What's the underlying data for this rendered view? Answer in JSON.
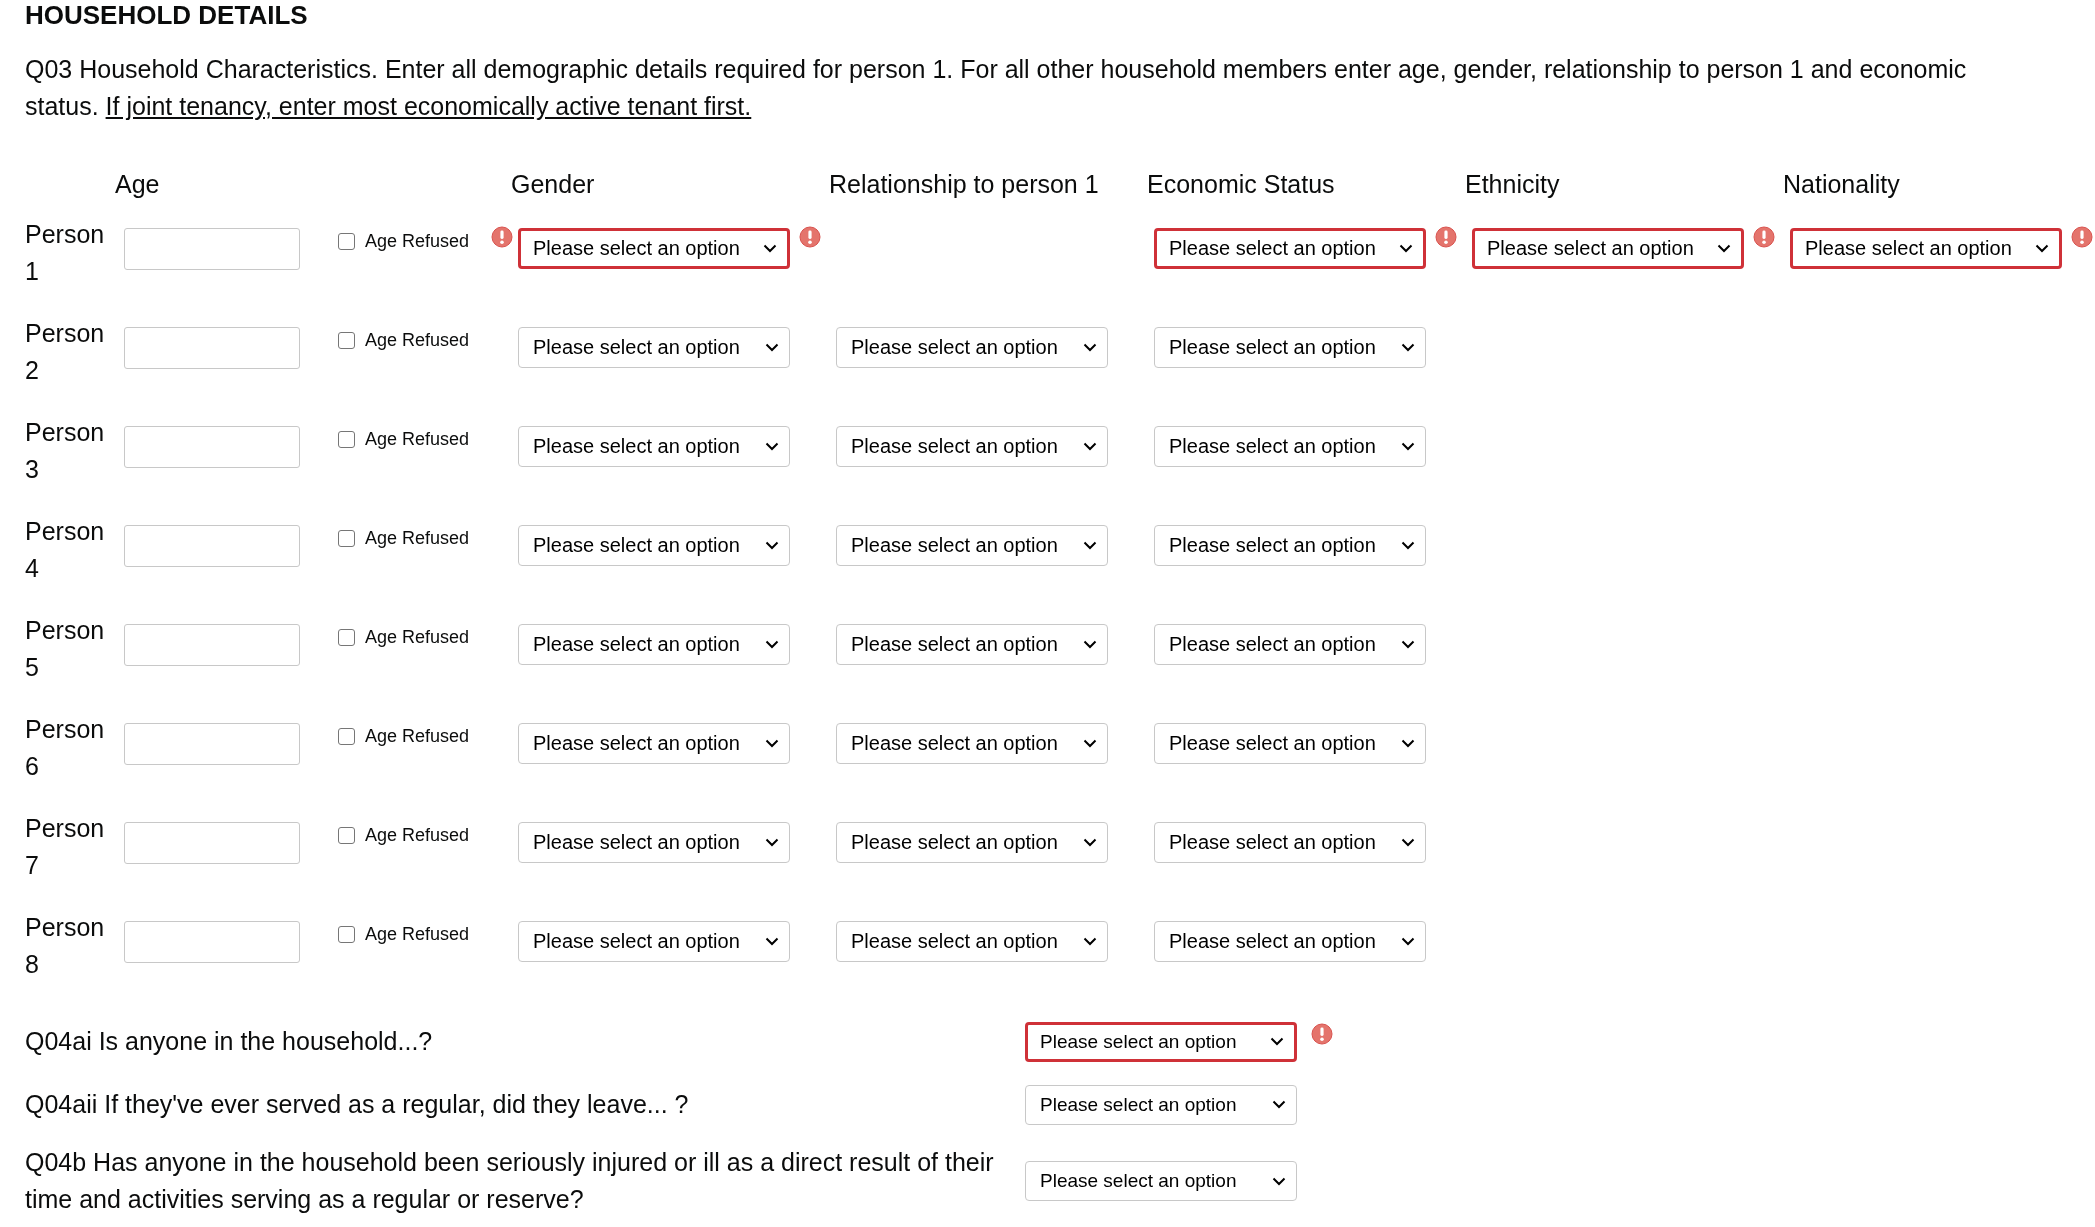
{
  "heading": "HOUSEHOLD DETAILS",
  "intro": {
    "text": "Q03 Household Characteristics. Enter all demographic details required for person 1. For all other household members enter age, gender, relationship to person 1 and economic status.",
    "link": "If joint tenancy, enter most economically active tenant first."
  },
  "columns": [
    "Age",
    "Gender",
    "Relationship to person 1",
    "Economic Status",
    "Ethnicity",
    "Nationality"
  ],
  "people": [
    {
      "label": "Person 1",
      "age_refused": {
        "label": "Age Refused",
        "checked": false,
        "error": true
      },
      "gender": {
        "value": "Please select an option",
        "invalid": true,
        "error": true
      },
      "economic_status": {
        "value": "Please select an option",
        "invalid": true,
        "error": true
      },
      "ethnicity": {
        "value": "Please select an option",
        "invalid": true,
        "error": true
      },
      "nationality": {
        "value": "Please select an option",
        "invalid": true,
        "error": true
      }
    },
    {
      "label": "Person 2",
      "age_refused": {
        "label": "Age Refused",
        "checked": false,
        "error": false
      },
      "gender": {
        "value": "Please select an option",
        "invalid": false,
        "error": false
      },
      "relationship": {
        "value": "Please select an option",
        "invalid": false,
        "error": false
      },
      "economic_status": {
        "value": "Please select an option",
        "invalid": false,
        "error": false
      }
    },
    {
      "label": "Person 3",
      "age_refused": {
        "label": "Age Refused",
        "checked": false,
        "error": false
      },
      "gender": {
        "value": "Please select an option",
        "invalid": false,
        "error": false
      },
      "relationship": {
        "value": "Please select an option",
        "invalid": false,
        "error": false
      },
      "economic_status": {
        "value": "Please select an option",
        "invalid": false,
        "error": false
      }
    },
    {
      "label": "Person 4",
      "age_refused": {
        "label": "Age Refused",
        "checked": false,
        "error": false
      },
      "gender": {
        "value": "Please select an option",
        "invalid": false,
        "error": false
      },
      "relationship": {
        "value": "Please select an option",
        "invalid": false,
        "error": false
      },
      "economic_status": {
        "value": "Please select an option",
        "invalid": false,
        "error": false
      }
    },
    {
      "label": "Person 5",
      "age_refused": {
        "label": "Age Refused",
        "checked": false,
        "error": false
      },
      "gender": {
        "value": "Please select an option",
        "invalid": false,
        "error": false
      },
      "relationship": {
        "value": "Please select an option",
        "invalid": false,
        "error": false
      },
      "economic_status": {
        "value": "Please select an option",
        "invalid": false,
        "error": false
      }
    },
    {
      "label": "Person 6",
      "age_refused": {
        "label": "Age Refused",
        "checked": false,
        "error": false
      },
      "gender": {
        "value": "Please select an option",
        "invalid": false,
        "error": false
      },
      "relationship": {
        "value": "Please select an option",
        "invalid": false,
        "error": false
      },
      "economic_status": {
        "value": "Please select an option",
        "invalid": false,
        "error": false
      }
    },
    {
      "label": "Person 7",
      "age_refused": {
        "label": "Age Refused",
        "checked": false,
        "error": false
      },
      "gender": {
        "value": "Please select an option",
        "invalid": false,
        "error": false
      },
      "relationship": {
        "value": "Please select an option",
        "invalid": false,
        "error": false
      },
      "economic_status": {
        "value": "Please select an option",
        "invalid": false,
        "error": false
      }
    },
    {
      "label": "Person 8",
      "age_refused": {
        "label": "Age Refused",
        "checked": false,
        "error": false
      },
      "gender": {
        "value": "Please select an option",
        "invalid": false,
        "error": false
      },
      "relationship": {
        "value": "Please select an option",
        "invalid": false,
        "error": false
      },
      "economic_status": {
        "value": "Please select an option",
        "invalid": false,
        "error": false
      }
    }
  ],
  "questions": [
    {
      "text": "Q04ai Is anyone in the household...?",
      "select": {
        "value": "Please select an option",
        "invalid": true,
        "error": true
      }
    },
    {
      "text": "Q04aii If they've ever served as a regular, did they leave... ?",
      "select": {
        "value": "Please select an option",
        "invalid": false,
        "error": false
      }
    },
    {
      "text": "Q04b Has anyone in the household been seriously injured or ill as a direct result of their time and activities serving as a regular or reserve?",
      "select": {
        "value": "Please select an option",
        "invalid": false,
        "error": false
      }
    }
  ]
}
